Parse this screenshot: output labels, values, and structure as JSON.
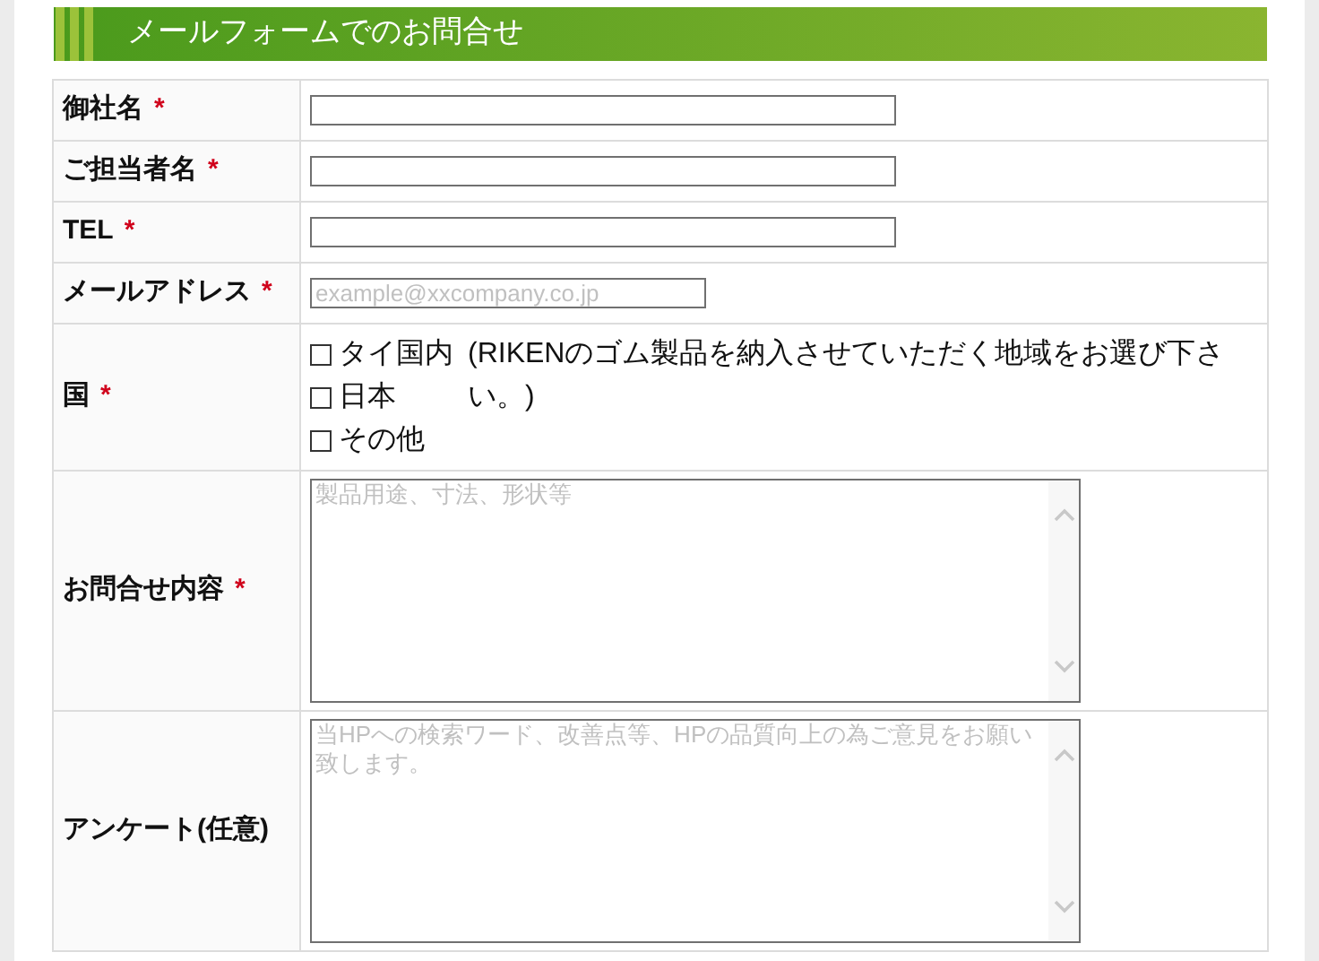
{
  "heading": "メールフォームでのお問合せ",
  "fields": [
    {
      "kind": "text",
      "label": "御社名",
      "required_mark": "*"
    },
    {
      "kind": "text",
      "label": "ご担当者名",
      "required_mark": "*"
    },
    {
      "kind": "text",
      "label": "TEL",
      "required_mark": "*"
    },
    {
      "kind": "email",
      "label": "メールアドレス",
      "required_mark": "*",
      "placeholder": "example@xxcompany.co.jp"
    },
    {
      "kind": "checkboxes",
      "label": "国",
      "required_mark": "*",
      "options": [
        {
          "label": "タイ国内",
          "checked": false
        },
        {
          "label": "日本",
          "checked": false
        },
        {
          "label": "その他",
          "checked": false
        }
      ],
      "note": "(RIKENのゴム製品を納入させていただく地域をお選び下さい。)"
    },
    {
      "kind": "textarea",
      "label": "お問合せ内容",
      "required_mark": "*",
      "placeholder": "製品用途、寸法、形状等"
    },
    {
      "kind": "textarea",
      "label": "アンケート(任意)",
      "placeholder": "当HPへの検索ワード、改善点等、HPの品質向上の為ご意見をお願い致します。"
    }
  ]
}
